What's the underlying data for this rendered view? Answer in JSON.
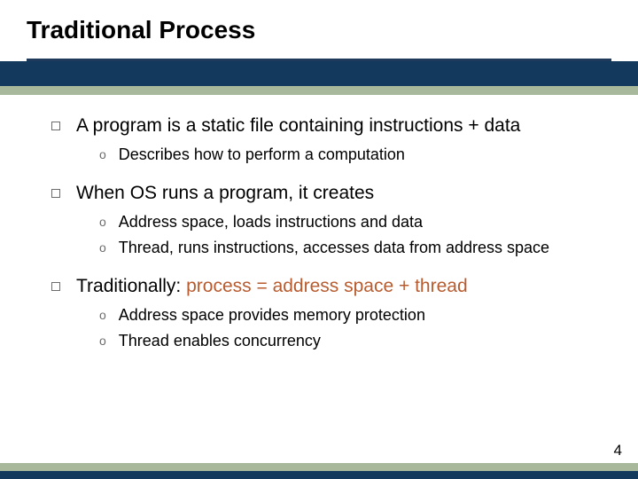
{
  "title": "Traditional Process",
  "page_number": "4",
  "colors": {
    "navy": "#13395d",
    "sage": "#a8b89a",
    "accent": "#b85c2f"
  },
  "bullets": [
    {
      "text": "A program is a static file containing instructions + data",
      "sub": [
        "Describes how to perform a computation"
      ]
    },
    {
      "text": "When OS runs a program, it creates",
      "sub": [
        "Address space, loads instructions and data",
        "Thread, runs instructions, accesses data from address space"
      ]
    },
    {
      "text_pre": "Traditionally: ",
      "text_accent": "process = address space + thread",
      "sub": [
        "Address space provides memory protection",
        "Thread enables concurrency"
      ]
    }
  ]
}
